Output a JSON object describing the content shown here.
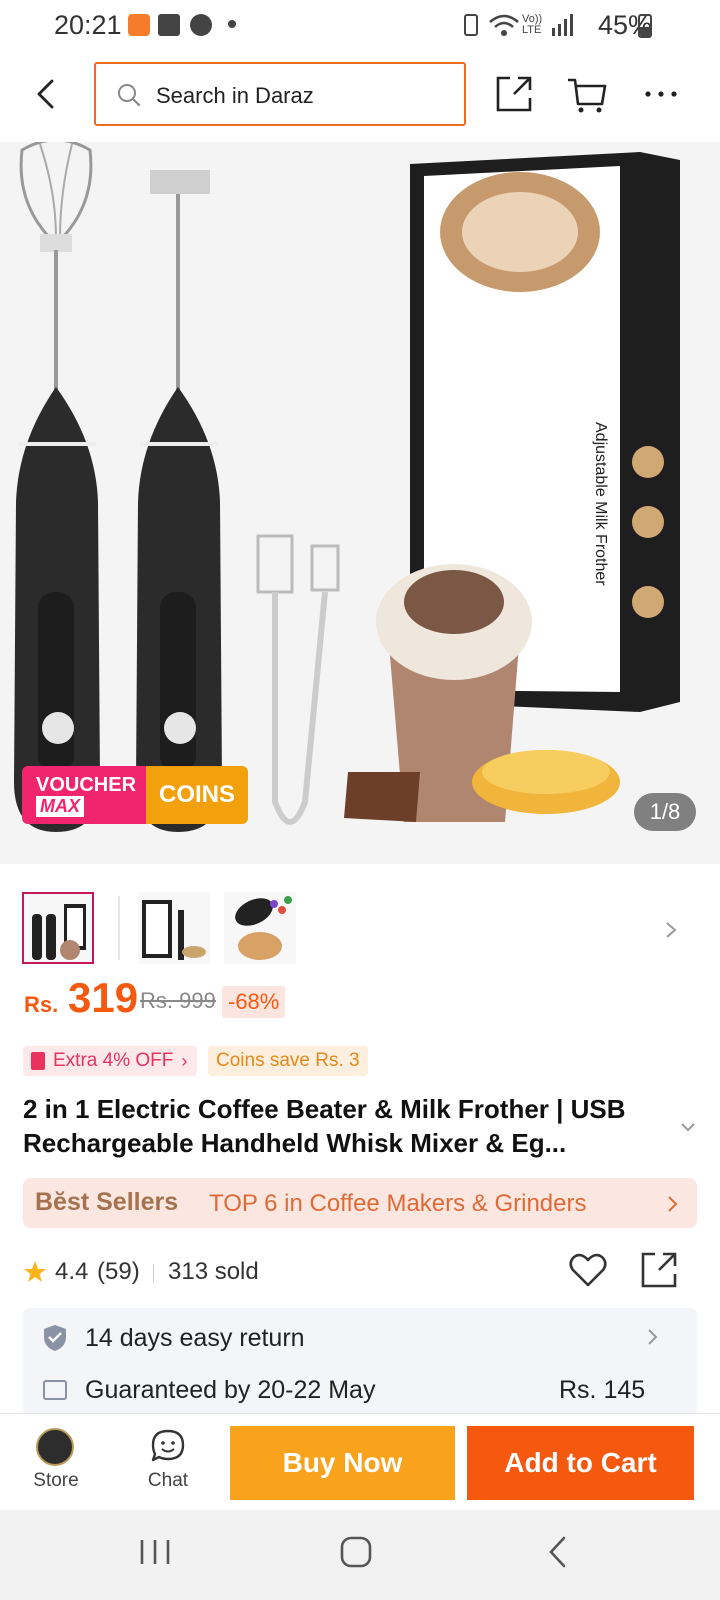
{
  "status": {
    "time": "20:21",
    "network": "Vo)) LTE",
    "battery": "45%"
  },
  "nav": {
    "search_placeholder": "Search in Daraz"
  },
  "gallery": {
    "counter": "1/8",
    "badge_voucher": "VOUCHER",
    "badge_max": "MAX",
    "badge_coins": "COINS",
    "box_text": "Adjustable Milk Frother",
    "current_index": 1,
    "total": 8
  },
  "price": {
    "currency": "Rs.",
    "current": "319",
    "original": "Rs. 999",
    "discount": "-68%"
  },
  "promos": {
    "extra_off": "Extra 4% OFF",
    "coins_save": "Coins save Rs. 3"
  },
  "product": {
    "title": "2 in 1 Electric Coffee Beater & Milk Frother | USB Rechargeable Handheld Whisk Mixer & Eg..."
  },
  "bestseller": {
    "label": "Bĕst Sellers",
    "text": "TOP 6 in Coffee Makers & Grinders"
  },
  "rating": {
    "score": "4.4",
    "count": "(59)",
    "sold": "313 sold"
  },
  "services": {
    "return": "14 days easy return",
    "delivery": "Guaranteed by 20-22 May",
    "delivery_fee": "Rs. 145"
  },
  "bottom": {
    "store_label": "Store",
    "chat_label": "Chat",
    "buy_now": "Buy Now",
    "add_to_cart": "Add to Cart"
  },
  "colors": {
    "brand_orange": "#f5590f",
    "buy_now": "#f9a21b",
    "add_to_cart": "#f5590f"
  }
}
